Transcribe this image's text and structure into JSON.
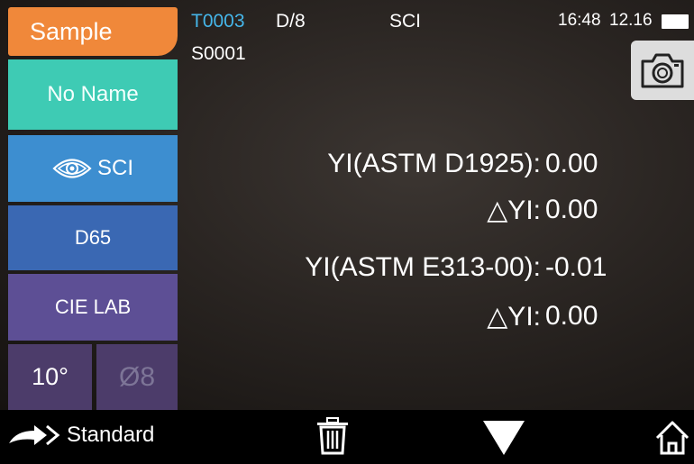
{
  "sidebar": {
    "sample_tab": "Sample",
    "name": "No Name",
    "mode_label": "SCI",
    "illuminant": "D65",
    "color_space": "CIE LAB",
    "observer": "10°",
    "aperture": "Ø8"
  },
  "header": {
    "test_code": "T0003",
    "geometry": "D/8",
    "mode": "SCI",
    "sample_code": "S0001",
    "time": "16:48",
    "date": "12.16"
  },
  "results": [
    {
      "label": "YI(ASTM D1925):",
      "value": "0.00"
    },
    {
      "label": "△YI:",
      "value": "0.00"
    },
    {
      "label": "YI(ASTM E313-00):",
      "value": "-0.01"
    },
    {
      "label": "△YI:",
      "value": "0.00"
    }
  ],
  "bottom_bar": {
    "standard_label": "Standard"
  },
  "colors": {
    "sample_tab": "#f0883a",
    "name": "#3ecbb4",
    "sci": "#3d8ed0",
    "illuminant": "#3a68b3",
    "color_space": "#5d4f95",
    "observer": "#4c3c6a",
    "test_code": "#45b5e8"
  },
  "icons": [
    "eye-icon",
    "battery-icon",
    "camera-icon",
    "arrow-right-icon",
    "trash-icon",
    "down-triangle-icon",
    "home-icon"
  ]
}
